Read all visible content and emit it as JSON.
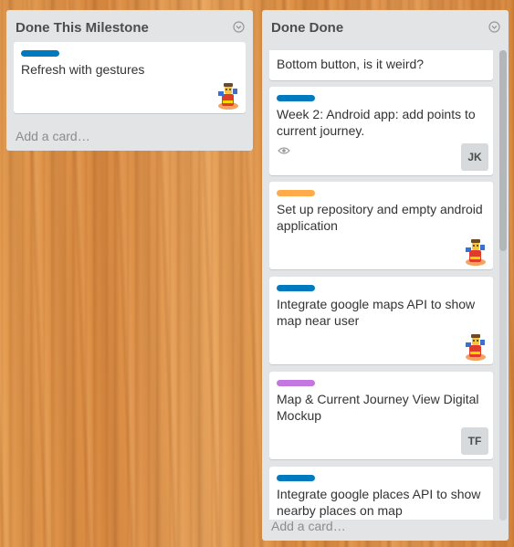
{
  "lists": [
    {
      "title": "Done This Milestone",
      "add_card": "Add a card…",
      "cards": [
        {
          "label_color": "#0079bf",
          "title": "Refresh with gestures",
          "member": "avatar"
        }
      ]
    },
    {
      "title": "Done Done",
      "add_card": "Add a card…",
      "cards": [
        {
          "title": "Bottom button, is it weird?"
        },
        {
          "label_color": "#0079bf",
          "title": "Week 2: Android app: add points to current journey.",
          "watch": "eye-icon",
          "member": "JK"
        },
        {
          "label_color": "#ffab4a",
          "title": "Set up repository and empty android application",
          "member": "avatar"
        },
        {
          "label_color": "#0079bf",
          "title": "Integrate google maps API to show map near user",
          "member": "avatar"
        },
        {
          "label_color": "#c377e0",
          "title": "Map & Current Journey View Digital Mockup",
          "member": "TF"
        },
        {
          "label_color": "#0079bf",
          "title": "Integrate google places API to show nearby places on map"
        }
      ]
    }
  ]
}
